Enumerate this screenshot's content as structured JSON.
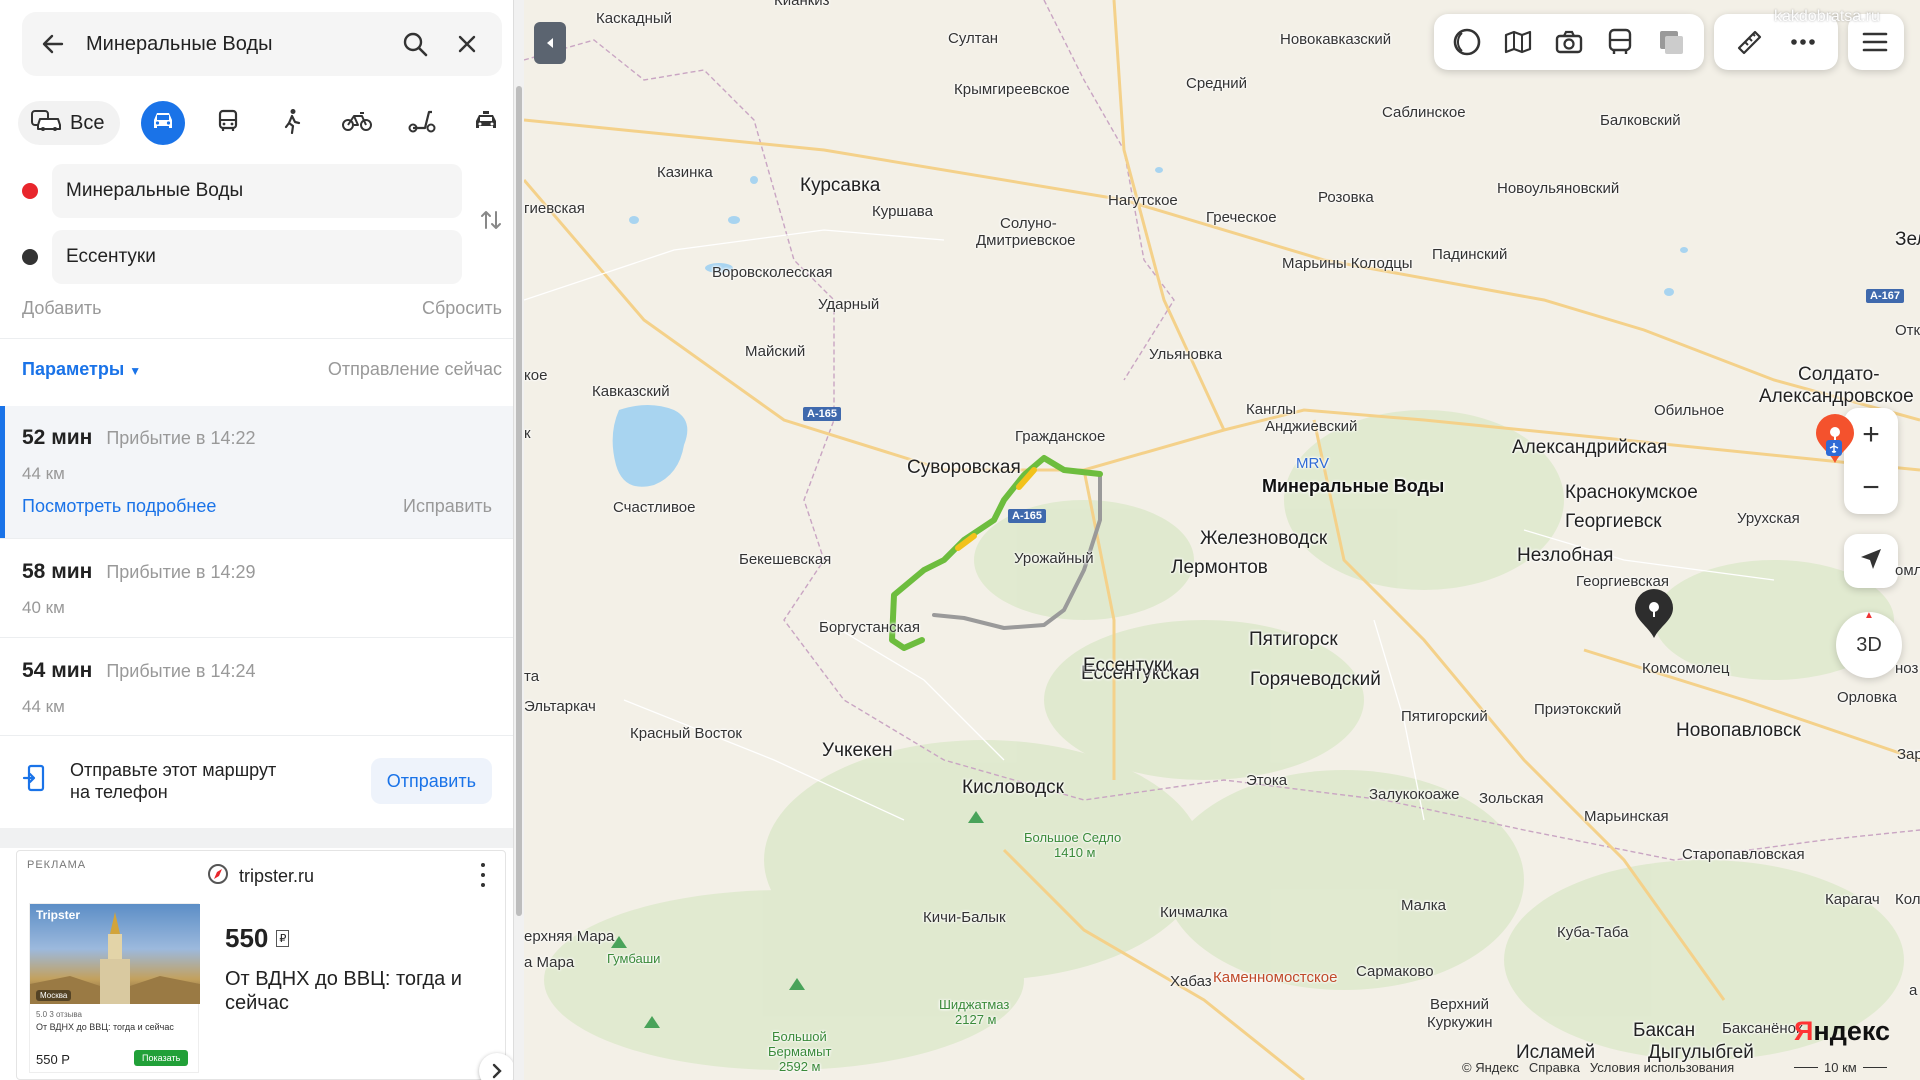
{
  "search": {
    "query": "Минеральные Воды"
  },
  "modes": {
    "all_label": "Все"
  },
  "waypoints": {
    "from": "Минеральные Воды",
    "to": "Ессентуки",
    "add": "Добавить",
    "reset": "Сбросить"
  },
  "params": {
    "label": "Параметры",
    "departure": "Отправление сейчас"
  },
  "routes": [
    {
      "time": "52 мин",
      "arrival": "Прибытие в 14:22",
      "distance": "44 км",
      "details": "Посмотреть подробнее",
      "edit": "Исправить"
    },
    {
      "time": "58 мин",
      "arrival": "Прибытие в 14:29",
      "distance": "40 км"
    },
    {
      "time": "54 мин",
      "arrival": "Прибытие в 14:24",
      "distance": "44 км"
    }
  ],
  "send": {
    "text_line1": "Отправьте этот маршрут",
    "text_line2": "на телефон",
    "button": "Отправить"
  },
  "ad": {
    "label": "РЕКЛАМА",
    "site": "tripster.ru",
    "price": "550",
    "title": "От ВДНХ до ВВЦ: тогда и сейчас",
    "pic_brand": "Tripster",
    "pic_city": "Москва",
    "pic_rating": "5.0 3 отзыва",
    "pic_title": "От ВДНХ до ВВЦ: тогда и сейчас",
    "pic_price": "550 Р",
    "pic_button": "Показать"
  },
  "map": {
    "watermark": "kakdobratsa.ru",
    "labels": {
      "kaskadny": "Каскадный",
      "kiankiz": "Кианкиз",
      "sultan": "Султан",
      "novokavkazsky": "Новокавказский",
      "krymgireevskoe": "Крымгиреевское",
      "sredny": "Средний",
      "sablinskoe": "Саблинское",
      "balkovsky": "Балковский",
      "kazinka": "Казинка",
      "kursavka": "Курсавка",
      "kurshava": "Куршава",
      "solunodm": "Солуно-",
      "solunodm2": "Дмитриевское",
      "nagutskoe": "Нагутское",
      "rozovka": "Розовка",
      "grecheskoe": "Греческое",
      "novoulyanovsky": "Новоульяновский",
      "ievskaya": "гиевская",
      "vorovskolesskaya": "Воровсколесская",
      "udarny": "Ударный",
      "maryiny": "Марьины Колодцы",
      "padinsky": "Падинский",
      "zele": "Зеле",
      "otka": "Отка",
      "maysky": "Майский",
      "ulyanovka": "Ульяновка",
      "koe": "кое",
      "kavkazsky": "Кавказский",
      "kangly": "Канглы",
      "andzhievsky": "Анджиевский",
      "obilnoe": "Обильное",
      "soldato": "Солдато-",
      "aleksandrovskoe": "Александровское",
      "grazhdanskoe": "Гражданское",
      "suvorovskaya": "Суворовская",
      "mrv": "MRV",
      "min_vody": "Минеральные Воды",
      "aleksandriyskaya": "Александрийская",
      "k": "к",
      "krasnokumskoe": "Краснокумское",
      "schastlivoe": "Счастливое",
      "zheleznovodsk": "Железноводск",
      "georgievsk": "Георгиевск",
      "urukhskaya": "Урухская",
      "lermontov": "Лермонтов",
      "bekeshevskaya": "Бекешевская",
      "urozhayny": "Урожайный",
      "nezlobnaya": "Незлобная",
      "georgievskaya": "Георгиевская",
      "borgustanskaya": "Боргустанская",
      "pyatigorsk": "Пятигорск",
      "essentuki": "Ессентуки",
      "essentukskaya": "Ессентукская",
      "goryachevodsky": "Горячеводский",
      "komsomolets": "Комсомолец",
      "ta": "та",
      "eltarkach": "Эльтаркач",
      "krasny_vostok": "Красный Восток",
      "pyatigorsky": "Пятигорский",
      "priyetokskiy": "Приэтокский",
      "orlovka": "Орловка",
      "novopavlovsk": "Новопавловск",
      "uchkeken": "Учкекен",
      "kislovodsk": "Кисловодск",
      "etoka": "Этока",
      "zalukokoazhe": "Залукокоаже",
      "zolskaya": "Зольская",
      "zare": "Заре",
      "marinskaya": "Марьинская",
      "bolshoe_sedlo": "Большое Седло",
      "bolshoe_sedlo_h": "1410 м",
      "staropavlovskaya": "Старопавловская",
      "malka": "Малка",
      "karagach": "Карагач",
      "kol": "Кол",
      "kichi_balyk": "Кичи-Балык",
      "kichmalka": "Кичмалка",
      "erkhnyaya_mara": "ерхняя Мара",
      "gumbashi": "Гумбаши",
      "a_mara": "а Мара",
      "kuba_taba": "Куба-Таба",
      "khabaz": "Хабаз",
      "kamennomostskoe": "Каменномостское",
      "sarmakovo": "Сармаково",
      "shidzhatmaz": "Шиджатмаз",
      "shidzhatmaz_h": "2127 м",
      "verkhny": "Верхний",
      "kurkuzhin": "Куркужин",
      "bolshoy_bermamyt": "Большой",
      "bolshoy_bermamyt2": "Бермамыт",
      "bolshoy_bermamyt_h": "2592 м",
      "baksan": "Баксан",
      "baksanenok": "Баксанёнок",
      "islamey": "Исламей",
      "dygulybgey": "Дыгулыбгей",
      "nozh": "ноз",
      "a": "а",
      "oml": "омл"
    },
    "shields": {
      "a165": "А-165",
      "a167": "А-167"
    },
    "zoom_in": "+",
    "zoom_out": "−",
    "three_d": "3D",
    "yandex_logo_1": "Я",
    "yandex_logo_2": "ндекс",
    "copyright": "© Яндекс",
    "help": "Справка",
    "terms": "Условия использования",
    "scale": "10 км"
  },
  "colors": {
    "accent": "#1a73e8",
    "route_green": "#6dbd3e",
    "route_gray": "#9a9a9a",
    "pin_red": "#f4522d"
  }
}
